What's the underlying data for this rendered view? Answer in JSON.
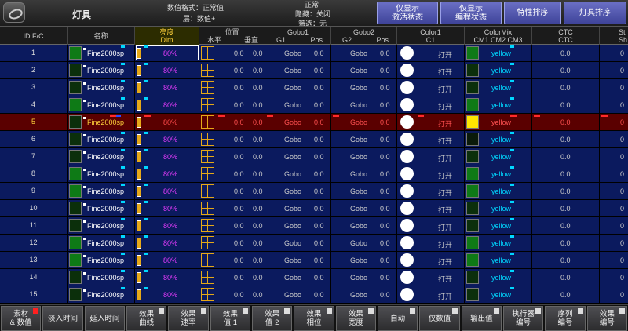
{
  "header": {
    "title": "灯具",
    "info_format": "数值格式：正常值",
    "info_layer": "层：数值+",
    "info_normal": "正常",
    "info_hide": "隐藏：关闭",
    "info_filter": "筛选：无",
    "buttons": [
      "仅显示\n激活状态",
      "仅显示\n编程状态",
      "特性排序",
      "灯具排序"
    ]
  },
  "columns": {
    "id": "ID F/C",
    "name": "名称",
    "dim_top": "亮度",
    "dim_bottom": "Dim",
    "pos_top": "位置",
    "pos_a": "水平",
    "pos_b": "垂直",
    "gobo1_top": "Gobo1",
    "gobo1_a": "G1",
    "gobo1_b": "Pos",
    "gobo2_top": "Gobo2",
    "gobo2_a": "G2",
    "gobo2_b": "Pos",
    "color1_top": "Color1",
    "color1_b": "C1",
    "cmix_top": "ColorMix",
    "cmix_b": "CM1 CM2 CM3",
    "ctc_top": "CTC",
    "ctc_b": "CTC",
    "st_top": "St",
    "st_b": "Sh"
  },
  "rows": [
    {
      "id": "1",
      "name": "Fine2000sp",
      "dim": "80%",
      "pan": "0.0",
      "tilt": "0.0",
      "g1": "Gobo",
      "g1p": "0.0",
      "g2": "Gobo",
      "g2p": "0.0",
      "c1": "打开",
      "cm": "yellow",
      "ctc": "0.0",
      "sh": "0",
      "swatch": "#0e7a16",
      "cmsw": "#0e7a16",
      "sel": false,
      "active": true
    },
    {
      "id": "2",
      "name": "Fine2000sp",
      "dim": "80%",
      "pan": "0.0",
      "tilt": "0.0",
      "g1": "Gobo",
      "g1p": "0.0",
      "g2": "Gobo",
      "g2p": "0.0",
      "c1": "打开",
      "cm": "yellow",
      "ctc": "0.0",
      "sh": "0",
      "swatch": "#0b2f0b",
      "cmsw": "#0b2f0b",
      "sel": false,
      "active": false
    },
    {
      "id": "3",
      "name": "Fine2000sp",
      "dim": "80%",
      "pan": "0.0",
      "tilt": "0.0",
      "g1": "Gobo",
      "g1p": "0.0",
      "g2": "Gobo",
      "g2p": "0.0",
      "c1": "打开",
      "cm": "yellow",
      "ctc": "0.0",
      "sh": "0",
      "swatch": "#0b2f0b",
      "cmsw": "#0b2f0b",
      "sel": false,
      "active": false
    },
    {
      "id": "4",
      "name": "Fine2000sp",
      "dim": "80%",
      "pan": "0.0",
      "tilt": "0.0",
      "g1": "Gobo",
      "g1p": "0.0",
      "g2": "Gobo",
      "g2p": "0.0",
      "c1": "打开",
      "cm": "yellow",
      "ctc": "0.0",
      "sh": "0",
      "swatch": "#0e7a16",
      "cmsw": "#0e7a16",
      "sel": false,
      "active": false
    },
    {
      "id": "5",
      "name": "Fine2000sp",
      "dim": "80%",
      "pan": "0.0",
      "tilt": "0.0",
      "g1": "Gobo",
      "g1p": "0.0",
      "g2": "Gobo",
      "g2p": "0.0",
      "c1": "打开",
      "cm": "yellow",
      "ctc": "0.0",
      "sh": "0",
      "swatch": "#0b2f0b",
      "cmsw": "#ffe600",
      "sel": true,
      "active": false
    },
    {
      "id": "6",
      "name": "Fine2000sp",
      "dim": "80%",
      "pan": "0.0",
      "tilt": "0.0",
      "g1": "Gobo",
      "g1p": "0.0",
      "g2": "Gobo",
      "g2p": "0.0",
      "c1": "打开",
      "cm": "yellow",
      "ctc": "0.0",
      "sh": "0",
      "swatch": "#0b2f0b",
      "cmsw": "#0a1a0a",
      "sel": false,
      "active": false
    },
    {
      "id": "7",
      "name": "Fine2000sp",
      "dim": "80%",
      "pan": "0.0",
      "tilt": "0.0",
      "g1": "Gobo",
      "g1p": "0.0",
      "g2": "Gobo",
      "g2p": "0.0",
      "c1": "打开",
      "cm": "yellow",
      "ctc": "0.0",
      "sh": "0",
      "swatch": "#0b2f0b",
      "cmsw": "#0b2f0b",
      "sel": false,
      "active": false
    },
    {
      "id": "8",
      "name": "Fine2000sp",
      "dim": "80%",
      "pan": "0.0",
      "tilt": "0.0",
      "g1": "Gobo",
      "g1p": "0.0",
      "g2": "Gobo",
      "g2p": "0.0",
      "c1": "打开",
      "cm": "yellow",
      "ctc": "0.0",
      "sh": "0",
      "swatch": "#0e7a16",
      "cmsw": "#0e7a16",
      "sel": false,
      "active": false
    },
    {
      "id": "9",
      "name": "Fine2000sp",
      "dim": "80%",
      "pan": "0.0",
      "tilt": "0.0",
      "g1": "Gobo",
      "g1p": "0.0",
      "g2": "Gobo",
      "g2p": "0.0",
      "c1": "打开",
      "cm": "yellow",
      "ctc": "0.0",
      "sh": "0",
      "swatch": "#0e7a16",
      "cmsw": "#0e7a16",
      "sel": false,
      "active": false
    },
    {
      "id": "10",
      "name": "Fine2000sp",
      "dim": "80%",
      "pan": "0.0",
      "tilt": "0.0",
      "g1": "Gobo",
      "g1p": "0.0",
      "g2": "Gobo",
      "g2p": "0.0",
      "c1": "打开",
      "cm": "yellow",
      "ctc": "0.0",
      "sh": "0",
      "swatch": "#0b2f0b",
      "cmsw": "#0b2f0b",
      "sel": false,
      "active": false
    },
    {
      "id": "11",
      "name": "Fine2000sp",
      "dim": "80%",
      "pan": "0.0",
      "tilt": "0.0",
      "g1": "Gobo",
      "g1p": "0.0",
      "g2": "Gobo",
      "g2p": "0.0",
      "c1": "打开",
      "cm": "yellow",
      "ctc": "0.0",
      "sh": "0",
      "swatch": "#0b2f0b",
      "cmsw": "#0b2f0b",
      "sel": false,
      "active": false
    },
    {
      "id": "12",
      "name": "Fine2000sp",
      "dim": "80%",
      "pan": "0.0",
      "tilt": "0.0",
      "g1": "Gobo",
      "g1p": "0.0",
      "g2": "Gobo",
      "g2p": "0.0",
      "c1": "打开",
      "cm": "yellow",
      "ctc": "0.0",
      "sh": "0",
      "swatch": "#0e7a16",
      "cmsw": "#0e7a16",
      "sel": false,
      "active": false
    },
    {
      "id": "13",
      "name": "Fine2000sp",
      "dim": "80%",
      "pan": "0.0",
      "tilt": "0.0",
      "g1": "Gobo",
      "g1p": "0.0",
      "g2": "Gobo",
      "g2p": "0.0",
      "c1": "打开",
      "cm": "yellow",
      "ctc": "0.0",
      "sh": "0",
      "swatch": "#0e7a16",
      "cmsw": "#0e7a16",
      "sel": false,
      "active": false
    },
    {
      "id": "14",
      "name": "Fine2000sp",
      "dim": "80%",
      "pan": "0.0",
      "tilt": "0.0",
      "g1": "Gobo",
      "g1p": "0.0",
      "g2": "Gobo",
      "g2p": "0.0",
      "c1": "打开",
      "cm": "yellow",
      "ctc": "0.0",
      "sh": "0",
      "swatch": "#0b2f0b",
      "cmsw": "#0b2f0b",
      "sel": false,
      "active": false
    },
    {
      "id": "15",
      "name": "Fine2000sp",
      "dim": "80%",
      "pan": "0.0",
      "tilt": "0.0",
      "g1": "Gobo",
      "g1p": "0.0",
      "g2": "Gobo",
      "g2p": "0.0",
      "c1": "打开",
      "cm": "yellow",
      "ctc": "0.0",
      "sh": "0",
      "swatch": "#0b2f0b",
      "cmsw": "#0b2f0b",
      "sel": false,
      "active": false
    }
  ],
  "bottom_buttons": [
    {
      "label": "素材\n& 数值",
      "ind": "red"
    },
    {
      "label": "淡入时间",
      "ind": "none"
    },
    {
      "label": "延入时间",
      "ind": "none"
    },
    {
      "label": "效果\n曲线",
      "ind": "white"
    },
    {
      "label": "效果\n速率",
      "ind": "white"
    },
    {
      "label": "效果\n值 1",
      "ind": "white"
    },
    {
      "label": "效果\n值 2",
      "ind": "white"
    },
    {
      "label": "效果\n相位",
      "ind": "white"
    },
    {
      "label": "效果\n宽度",
      "ind": "white"
    },
    {
      "label": "自动",
      "ind": "white"
    },
    {
      "label": "仅数值",
      "ind": "white"
    },
    {
      "label": "输出值",
      "ind": "white"
    },
    {
      "label": "执行器\n编号",
      "ind": "white"
    },
    {
      "label": "序列\n编号",
      "ind": "white"
    },
    {
      "label": "效果\n编号",
      "ind": "white"
    }
  ]
}
